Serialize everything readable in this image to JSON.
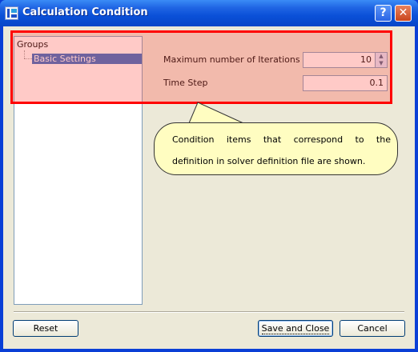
{
  "window": {
    "title": "Calculation Condition",
    "help_label": "?",
    "close_label": "✕"
  },
  "groups": {
    "header": "Groups",
    "items": [
      "Basic Settings"
    ]
  },
  "fields": {
    "iterations": {
      "label": "Maximum number of Iterations",
      "value": "10"
    },
    "time_step": {
      "label": "Time Step",
      "value": "0.1"
    }
  },
  "callout": {
    "line1_words": [
      "Condition",
      "items",
      "that",
      "correspond",
      "to",
      "the"
    ],
    "line2": "definition in solver definition file are shown."
  },
  "buttons": {
    "reset": "Reset",
    "save_close": "Save and Close",
    "cancel": "Cancel"
  },
  "colors": {
    "highlight": "#ff0000",
    "callout_bg": "#fffdc1",
    "selected_item": "#316ac5",
    "titlebar": "#0a50d8"
  }
}
